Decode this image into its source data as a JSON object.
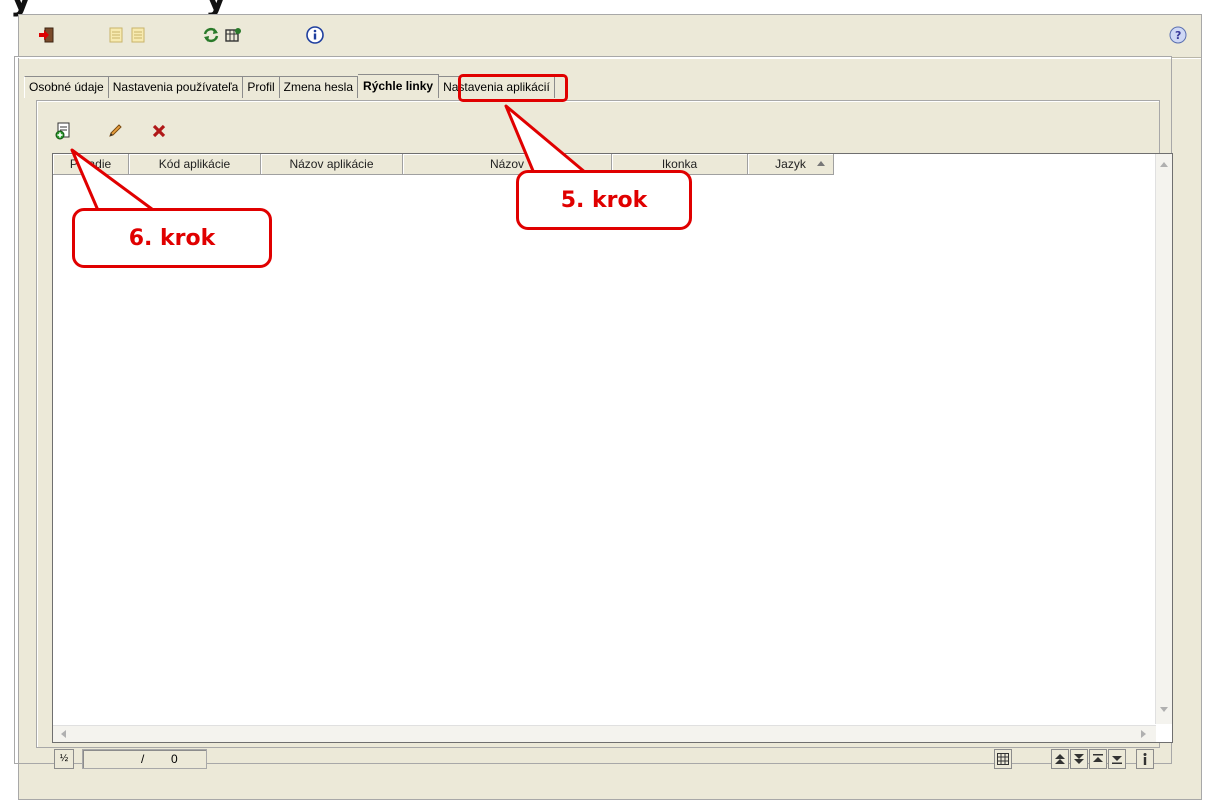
{
  "heading_fragment": "y",
  "toolbar": {
    "buttons": [
      {
        "icon": "exit-icon",
        "label": ""
      },
      {
        "icon": "document-icon",
        "label": ""
      },
      {
        "icon": "document-icon",
        "label": ""
      },
      {
        "icon": "refresh-icon",
        "label": ""
      },
      {
        "icon": "window-settings-icon",
        "label": ""
      },
      {
        "icon": "info-icon",
        "label": ""
      },
      {
        "icon": "help-icon",
        "label": ""
      }
    ]
  },
  "tabs": [
    {
      "label": "Osobné údaje",
      "active": false
    },
    {
      "label": "Nastavenia používateľa",
      "active": false
    },
    {
      "label": "Profil",
      "active": false
    },
    {
      "label": "Zmena hesla",
      "active": false
    },
    {
      "label": "Rýchle linky",
      "active": true
    },
    {
      "label": "Nastavenia aplikácií",
      "active": false
    }
  ],
  "grid_toolbar": {
    "buttons": [
      "add-icon",
      "edit-icon",
      "delete-icon"
    ]
  },
  "grid": {
    "columns": [
      "Poradie",
      "Kód aplikácie",
      "Názov aplikácie",
      "Názov",
      "Ikonka",
      "Jazyk"
    ],
    "rows": []
  },
  "status": {
    "page_icon": "½",
    "separator": "/",
    "total": "0"
  },
  "annotations": {
    "step5": "5. krok",
    "step6": "6. krok"
  },
  "colors": {
    "accent": "#e00000",
    "window_bg": "#ece9d8"
  }
}
